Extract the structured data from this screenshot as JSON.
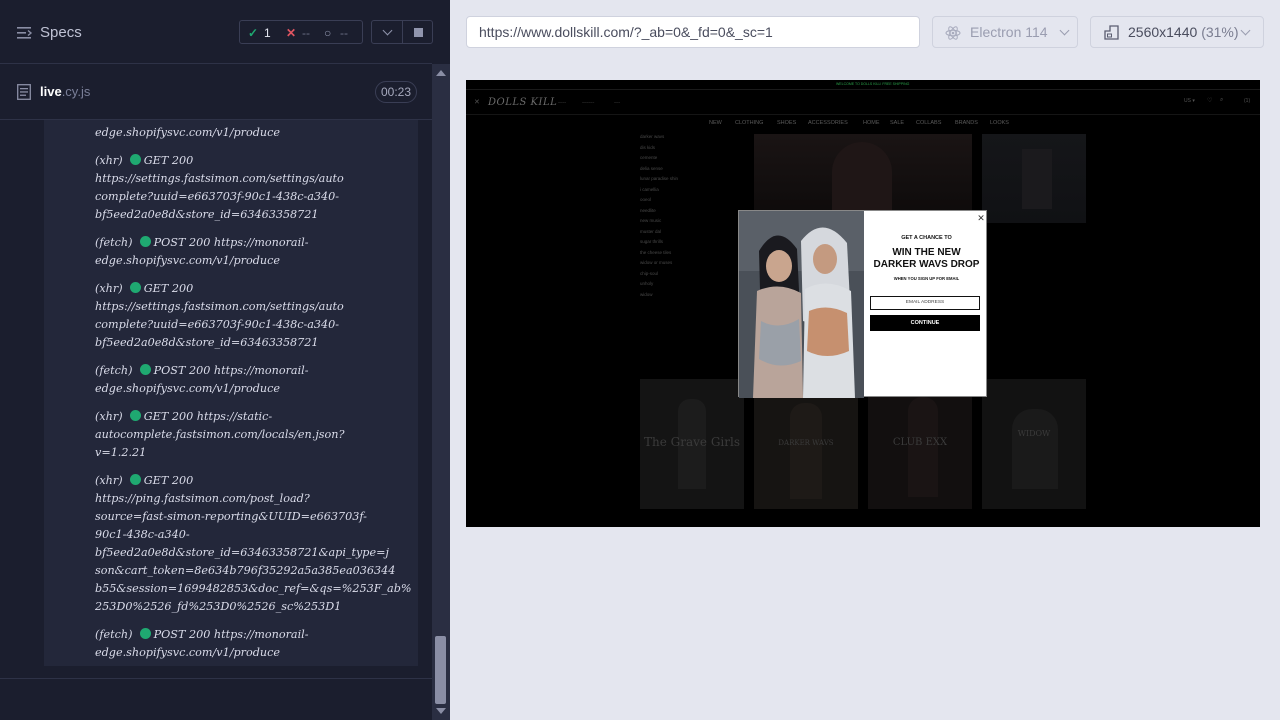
{
  "reporter": {
    "specs_title": "Specs",
    "stats": {
      "passed": "1",
      "failed": "--",
      "pending": "--"
    },
    "file": {
      "name": "live",
      "ext": ".cy.js",
      "timer": "00:23"
    },
    "logs": [
      {
        "prefix": "",
        "lines": [
          "edge.shopifysvc.com/v1/produce"
        ]
      },
      {
        "prefix": "(xhr)",
        "method": "GET 200",
        "lines": [
          "https://settings.fastsimon.com/settings/auto",
          "complete?uuid=e663703f-90c1-438c-a340-",
          "bf5eed2a0e8d&store_id=63463358721"
        ]
      },
      {
        "prefix": "(fetch)",
        "method": "POST 200 https://monorail-",
        "lines": [
          "edge.shopifysvc.com/v1/produce"
        ]
      },
      {
        "prefix": "(xhr)",
        "method": "GET 200",
        "lines": [
          "https://settings.fastsimon.com/settings/auto",
          "complete?uuid=e663703f-90c1-438c-a340-",
          "bf5eed2a0e8d&store_id=63463358721"
        ]
      },
      {
        "prefix": "(fetch)",
        "method": "POST 200 https://monorail-",
        "lines": [
          "edge.shopifysvc.com/v1/produce"
        ]
      },
      {
        "prefix": "(xhr)",
        "method": "GET 200 https://static-",
        "lines": [
          "autocomplete.fastsimon.com/locals/en.json?",
          "v=1.2.21"
        ]
      },
      {
        "prefix": "(xhr)",
        "method": "GET 200",
        "lines": [
          "https://ping.fastsimon.com/post_load?",
          "source=fast-simon-reporting&UUID=e663703f-",
          "90c1-438c-a340-",
          "bf5eed2a0e8d&store_id=63463358721&api_type=j",
          "son&cart_token=8e634b796f35292a5a385ea036344",
          "b55&session=1699482853&doc_ref=&qs=%253F_ab%",
          "253D0%2526_fd%253D0%2526_sc%253D1"
        ]
      },
      {
        "prefix": "(fetch)",
        "method": "POST 200 https://monorail-",
        "lines": [
          "edge.shopifysvc.com/v1/produce"
        ]
      }
    ]
  },
  "aut_header": {
    "url": "https://www.dollskill.com/?_ab=0&_fd=0&_sc=1",
    "browser": "Electron 114",
    "viewport": "2560x1440",
    "scale": "(31%)"
  },
  "site": {
    "promo": "WELCOME TO DOLLS KILL! FREE SHIPPING",
    "logo": "DOLLS KILL",
    "nav": [
      "NEW",
      "CLOTHING",
      "SHOES",
      "ACCESSORIES",
      "HOME",
      "SALE",
      "COLLABS",
      "BRANDS",
      "LOOKS"
    ],
    "categories": [
      "darker wavs",
      "dis kids",
      "cemente",
      "delia sense",
      "lunar paradise shin",
      "i camellia",
      "ooeol",
      "needlite",
      "new music",
      "muster dal",
      "sugar thrills",
      "the cheese tiles",
      "widow or muses",
      "chip-soul",
      "unholy",
      "widow"
    ],
    "tiles": [
      "The Grave Girls",
      "DARKER WAVS",
      "CLUB EXX",
      "WIDOW"
    ],
    "popup": {
      "kicker": "GET A CHANCE TO",
      "title": "WIN THE NEW\nDARKER WAVS DROP",
      "subtitle": "WHEN YOU SIGN UP FOR EMAIL",
      "email_placeholder": "EMAIL ADDRESS",
      "cta": "CONTINUE"
    }
  },
  "colors": {
    "pass": "#1fa971",
    "fail": "#e05561",
    "reporter_bg": "#1b1e2e"
  }
}
